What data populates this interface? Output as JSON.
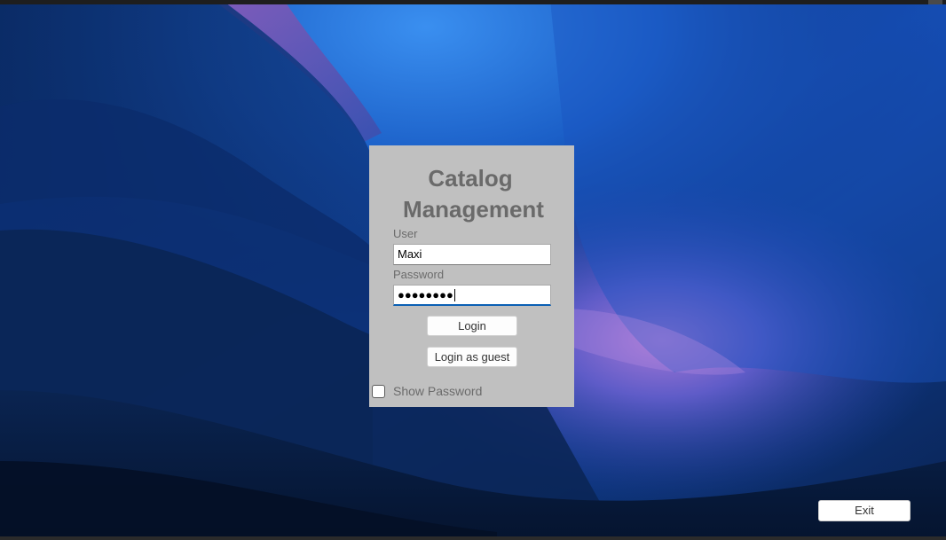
{
  "app": {
    "title_line1": "Catalog",
    "title_line2": "Management"
  },
  "login": {
    "user_label": "User",
    "user_value": "Maxi",
    "password_label": "Password",
    "password_masked": "●●●●●●●●",
    "login_button": "Login",
    "guest_button": "Login as guest",
    "show_password_label": "Show Password",
    "show_password_checked": false
  },
  "footer": {
    "exit_button": "Exit"
  },
  "colors": {
    "panel_bg": "#c0c0c0",
    "title_text": "#6a6a6a",
    "focus_accent": "#0a5fb4",
    "wallpaper_base": "#0b2a66"
  }
}
